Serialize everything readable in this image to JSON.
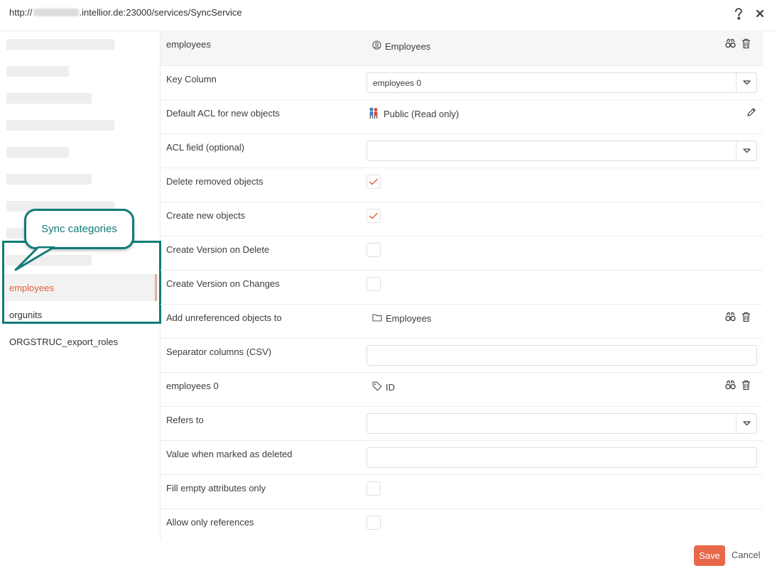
{
  "header": {
    "url_prefix": "http://",
    "url_suffix": ".intellior.de:23000/services/SyncService",
    "help_icon": "help-question-icon",
    "close_icon": "close-icon"
  },
  "sidebar": {
    "categories": [
      {
        "label": "employees",
        "active": true
      },
      {
        "label": "orgunits",
        "active": false
      },
      {
        "label": "ORGSTRUC_export_roles",
        "active": false
      }
    ]
  },
  "callout": {
    "text": "Sync categories"
  },
  "form": {
    "header_row": {
      "label": "employees",
      "value": "Employees",
      "icon": "user-circle-icon"
    },
    "key_column": {
      "label": "Key Column",
      "value": "employees 0"
    },
    "default_acl": {
      "label": "Default ACL for new objects",
      "value": "Public (Read only)",
      "icon": "acl-people-icon"
    },
    "acl_field": {
      "label": "ACL field (optional)",
      "value": ""
    },
    "delete_removed": {
      "label": "Delete removed objects",
      "checked": true
    },
    "create_new": {
      "label": "Create new objects",
      "checked": true
    },
    "version_on_delete": {
      "label": "Create Version on Delete",
      "checked": false
    },
    "version_on_changes": {
      "label": "Create Version on Changes",
      "checked": false
    },
    "add_unreferenced": {
      "label": "Add unreferenced objects to",
      "value": "Employees",
      "icon": "folder-icon"
    },
    "separator_columns": {
      "label": "Separator columns (CSV)",
      "value": ""
    },
    "attribute_row": {
      "label": "employees 0",
      "value": "ID",
      "icon": "tag-icon"
    },
    "refers_to": {
      "label": "Refers to",
      "value": ""
    },
    "value_deleted": {
      "label": "Value when marked as deleted",
      "value": ""
    },
    "fill_empty": {
      "label": "Fill empty attributes only",
      "checked": false
    },
    "allow_references": {
      "label": "Allow only references",
      "checked": false
    }
  },
  "footer": {
    "save_label": "Save",
    "cancel_label": "Cancel"
  },
  "colors": {
    "accent": "#e8684a",
    "active_text": "#e0603c",
    "callout_teal": "#0f7b79"
  }
}
